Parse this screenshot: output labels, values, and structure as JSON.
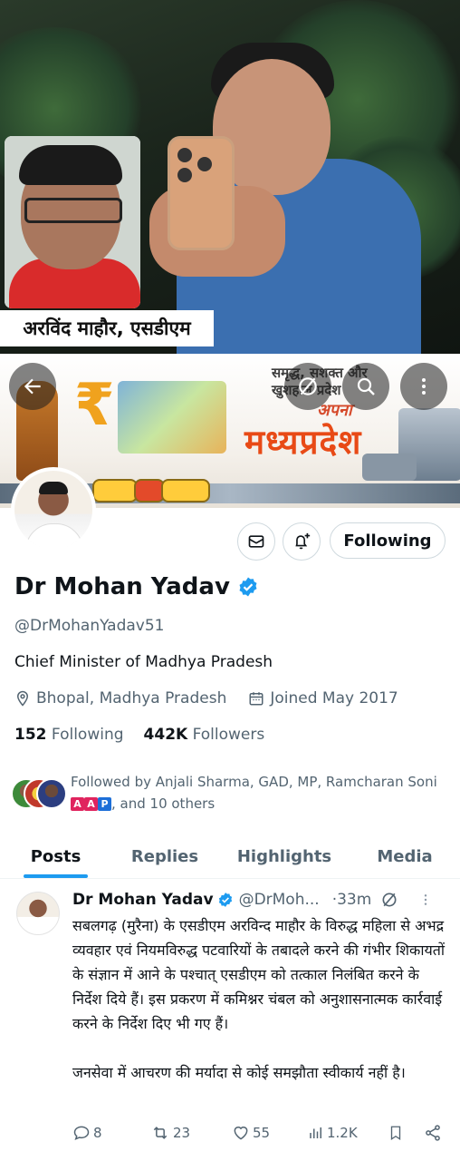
{
  "news_image": {
    "caption": "अरविंद माहौर, एसडीएम"
  },
  "banner": {
    "tagline": "समृद्ध, सशक्त और खुशहाल प्रदेश",
    "apna": "अपना",
    "state": "मध्यप्रदेश"
  },
  "profile": {
    "display_name": "Dr Mohan Yadav",
    "verified": true,
    "handle": "@DrMohanYadav51",
    "bio": "Chief Minister of Madhya Pradesh",
    "location": "Bhopal, Madhya Pradesh",
    "joined": "Joined May 2017",
    "following_count": "152",
    "following_label": "Following",
    "followers_count": "442K",
    "followers_label": "Followers",
    "follow_button": "Following",
    "followed_by_prefix": "Followed by Anjali Sharma, GAD, MP, Ramcharan Soni",
    "followed_by_badges": [
      "A",
      "A",
      "P"
    ],
    "followed_by_suffix": ", and 10 others"
  },
  "tabs": [
    "Posts",
    "Replies",
    "Highlights",
    "Media"
  ],
  "active_tab": "Posts",
  "post": {
    "author": "Dr Mohan Yadav",
    "handle": "@DrMoh...",
    "time": "·33m",
    "text": "सबलगढ़ (मुरैना) के एसडीएम अरविन्द माहौर के विरुद्ध महिला से अभद्र व्यवहार एवं नियमविरुद्ध पटवारियों के तबादले करने की गंभीर शिकायतों के संज्ञान में आने के पश्चात् एसडीएम को तत्काल निलंबित करने के निर्देश दिये हैं। इस प्रकरण में कमिश्नर चंबल को अनुशासनात्मक कार्रवाई करने के निर्देश दिए भी गए हैं।\n\nजनसेवा में आचरण की मर्यादा से कोई समझौता स्वीकार्य नहीं है।",
    "replies": "8",
    "reposts": "23",
    "likes": "55",
    "views": "1.2K"
  },
  "colors": {
    "accent": "#1d9bf0",
    "text_primary": "#0f1419",
    "text_secondary": "#536471",
    "border": "#cfd9de"
  },
  "icons": [
    "back-arrow-icon",
    "mute-icon",
    "search-icon",
    "more-vertical-icon",
    "mail-icon",
    "bell-plus-icon",
    "verified-badge-icon",
    "location-pin-icon",
    "calendar-icon",
    "reply-icon",
    "repost-icon",
    "like-icon",
    "views-icon",
    "bookmark-icon",
    "share-icon"
  ]
}
